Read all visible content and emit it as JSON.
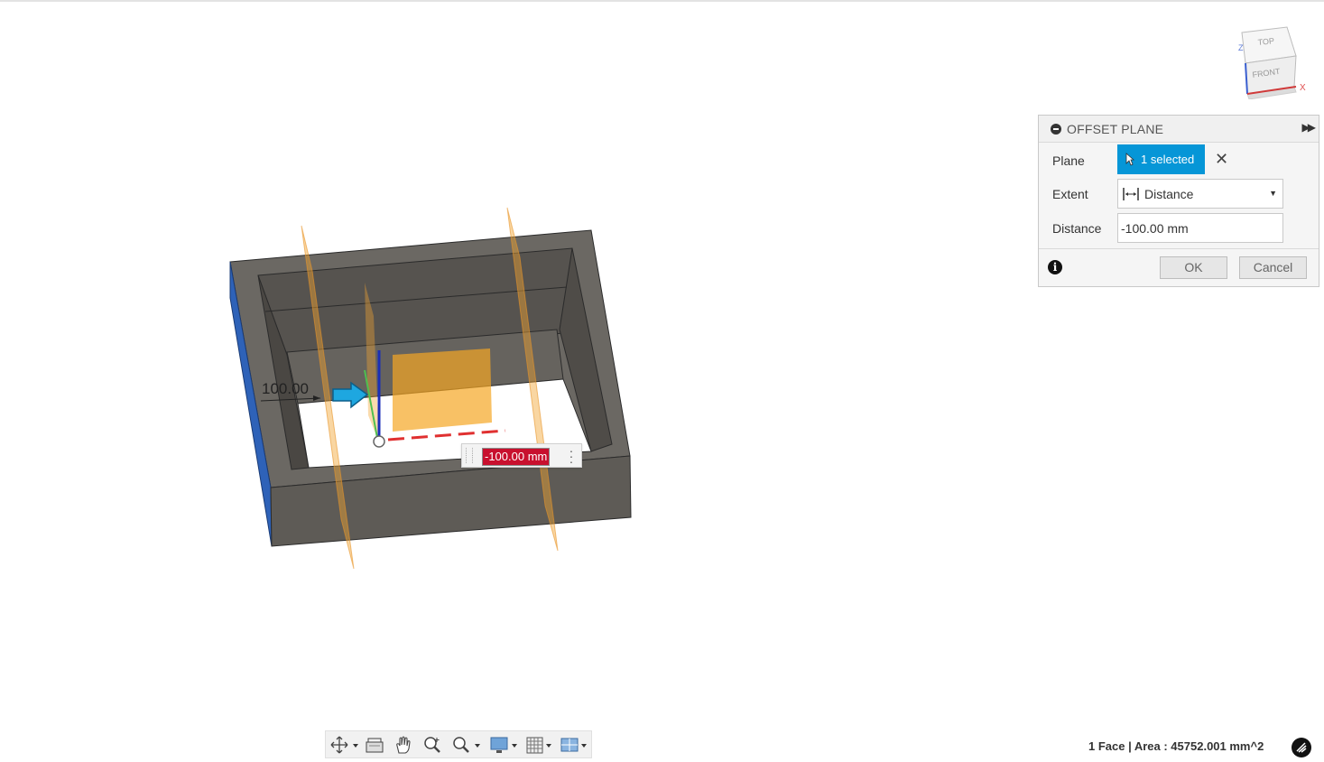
{
  "dialog": {
    "title": "OFFSET PLANE",
    "plane_label": "Plane",
    "plane_selection": "1 selected",
    "extent_label": "Extent",
    "extent_value": "Distance",
    "distance_label": "Distance",
    "distance_value": "-100.00 mm",
    "ok_label": "OK",
    "cancel_label": "Cancel",
    "accent_color": "#0696d7"
  },
  "canvas": {
    "dimension_label": "100.00",
    "offset_value": "-100.00 mm"
  },
  "viewcube": {
    "top_label": "TOP",
    "front_label": "FRONT",
    "z_axis": "Z",
    "x_axis": "X"
  },
  "toolbar": {
    "icons": [
      "orbit-icon",
      "look-at-icon",
      "pan-icon",
      "zoom-icon",
      "zoom-window-icon",
      "display-settings-icon",
      "grid-settings-icon",
      "viewports-icon"
    ]
  },
  "status": {
    "text": "1 Face | Area : 45752.001 mm^2"
  }
}
